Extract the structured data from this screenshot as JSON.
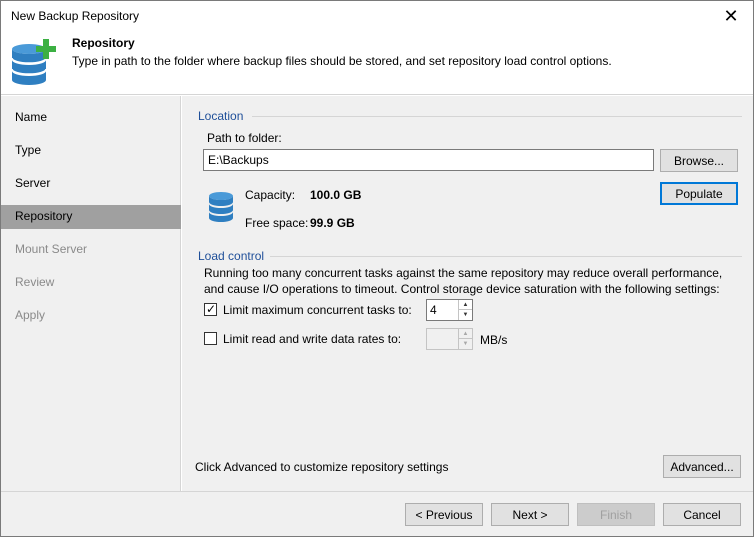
{
  "window": {
    "title": "New Backup Repository",
    "close_glyph": "✕"
  },
  "header": {
    "title": "Repository",
    "description": "Type in path to the folder where backup files should be stored, and set repository load control options.",
    "icon": "database-add-icon"
  },
  "sidebar": {
    "items": [
      {
        "label": "Name",
        "state": "normal"
      },
      {
        "label": "Type",
        "state": "normal"
      },
      {
        "label": "Server",
        "state": "normal"
      },
      {
        "label": "Repository",
        "state": "active"
      },
      {
        "label": "Mount Server",
        "state": "disabled"
      },
      {
        "label": "Review",
        "state": "disabled"
      },
      {
        "label": "Apply",
        "state": "disabled"
      }
    ]
  },
  "location": {
    "group_label": "Location",
    "path_label": "Path to folder:",
    "path_value": "E:\\Backups",
    "browse_label": "Browse...",
    "capacity_label": "Capacity:",
    "capacity_value": "100.0 GB",
    "free_label": "Free space:",
    "free_value": "99.9 GB",
    "populate_label": "Populate",
    "storage_icon": "database-icon"
  },
  "load_control": {
    "group_label": "Load control",
    "description_line1": "Running too many concurrent tasks against the same repository may reduce overall performance,",
    "description_line2": "and cause I/O operations to timeout. Control storage device saturation with the following settings:",
    "limit_tasks_label": "Limit maximum concurrent tasks to:",
    "limit_tasks_checked": true,
    "limit_tasks_value": "4",
    "limit_rate_label": "Limit read and write data rates to:",
    "limit_rate_checked": false,
    "limit_rate_value": "",
    "rate_unit": "MB/s"
  },
  "advanced": {
    "hint": "Click Advanced to customize repository settings",
    "button_label": "Advanced..."
  },
  "footer": {
    "previous_label": "< Previous",
    "next_label": "Next >",
    "finish_label": "Finish",
    "cancel_label": "Cancel"
  },
  "colors": {
    "accent": "#0078d7",
    "group_label": "#1f4f99",
    "icon_blue": "#2f7fc1",
    "icon_green": "#3cb043"
  }
}
